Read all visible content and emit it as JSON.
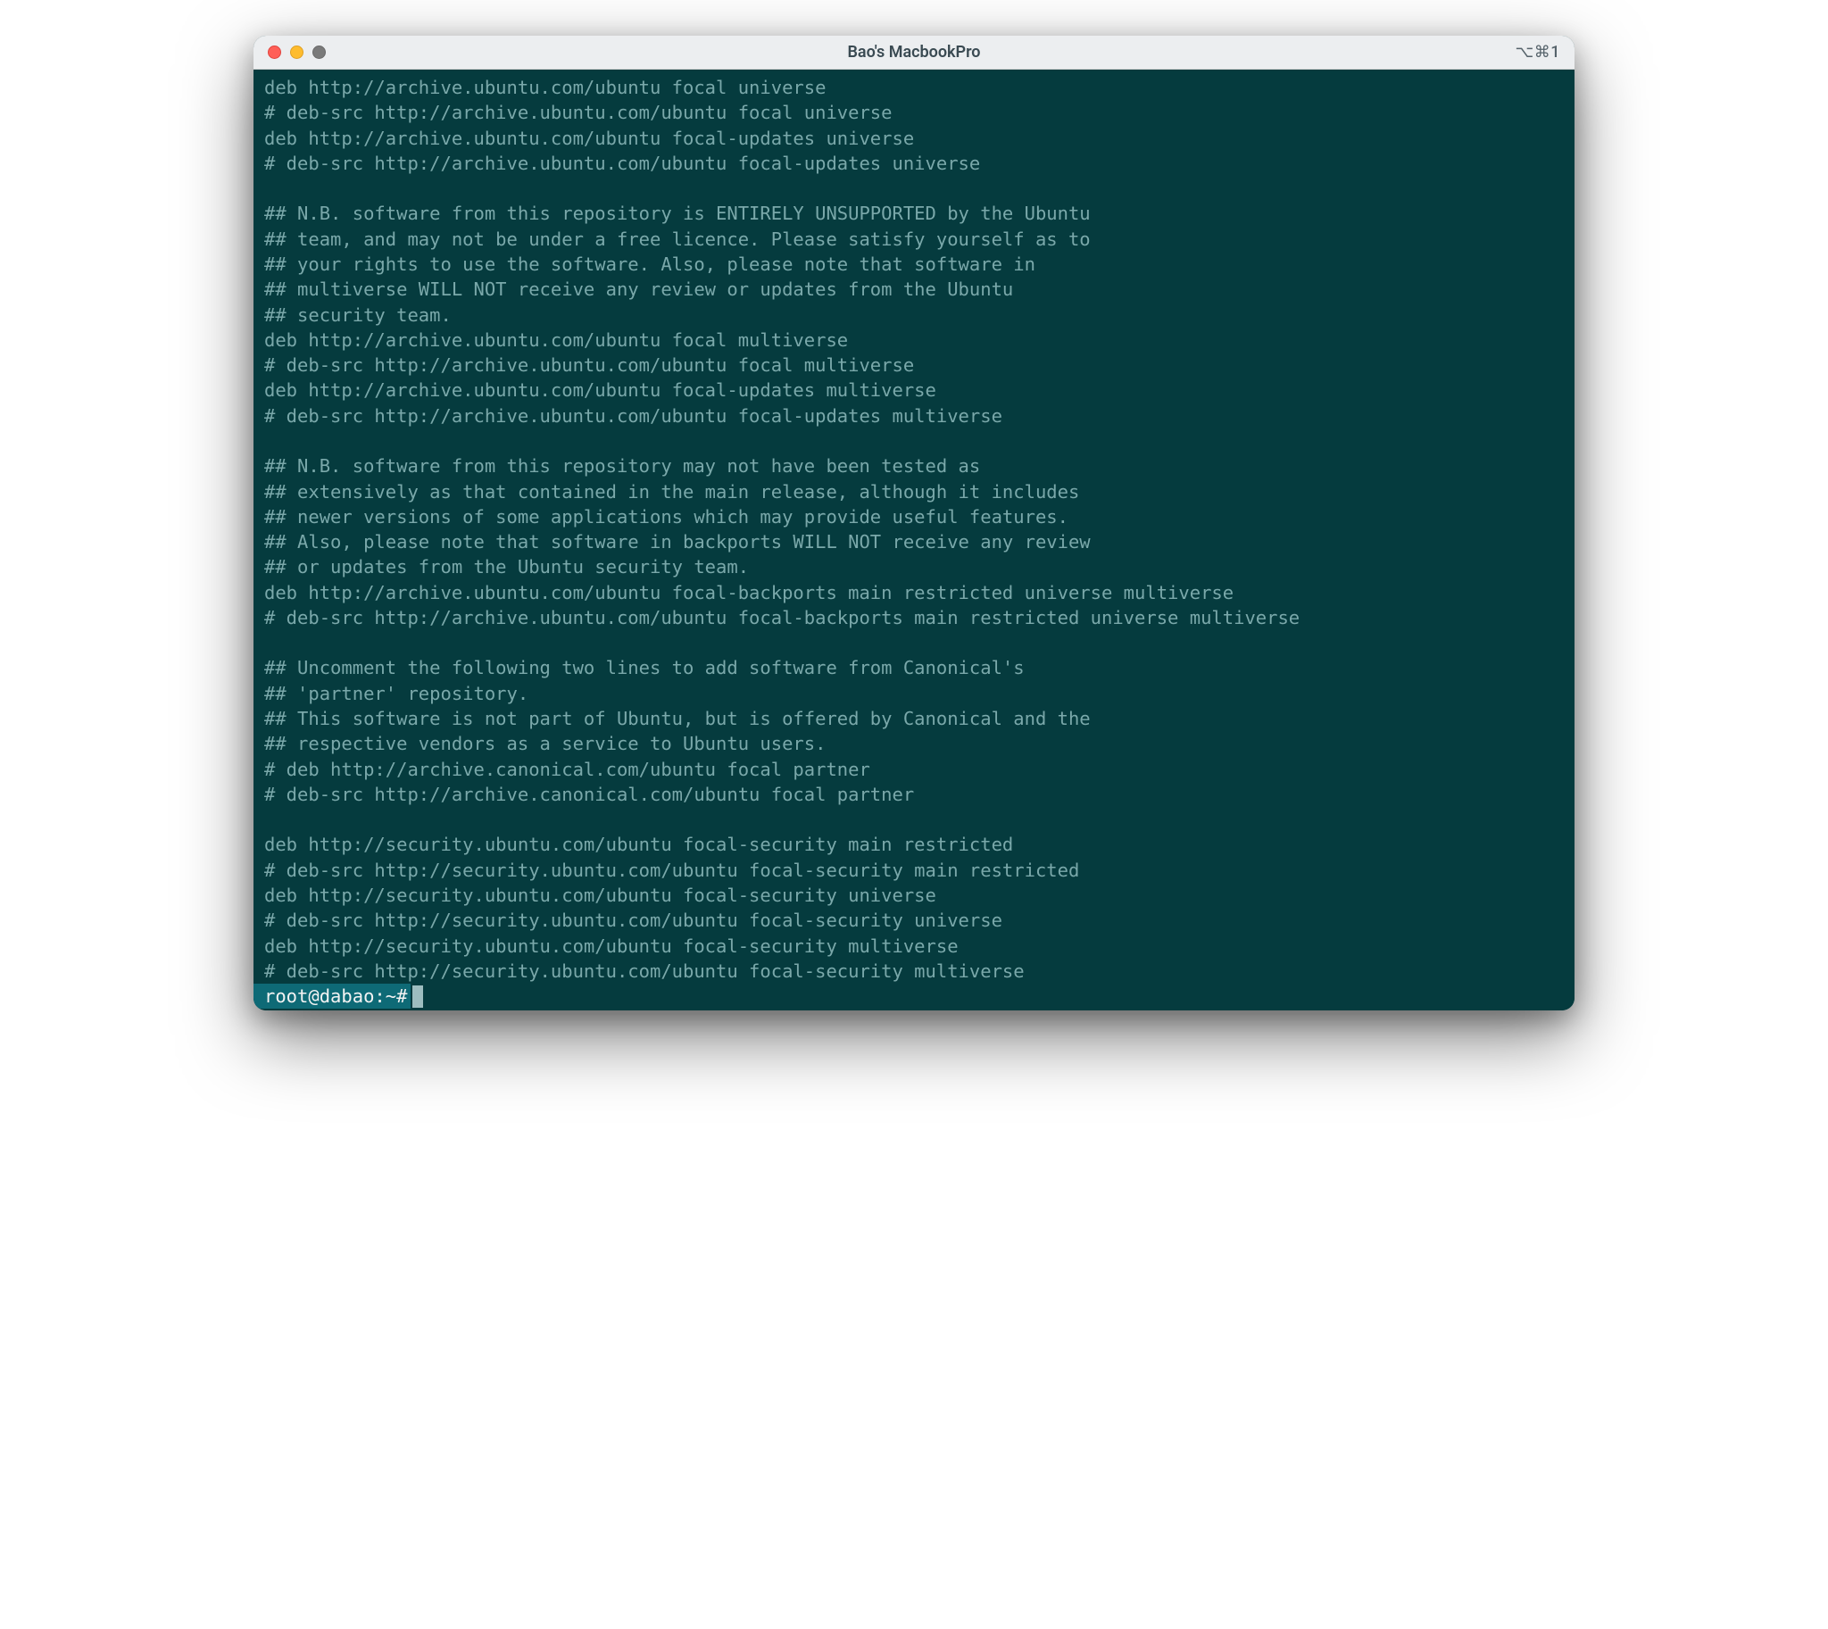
{
  "window": {
    "title": "Bao's MacbookPro",
    "shortcut": "⌥⌘1"
  },
  "terminal": {
    "lines": [
      "deb http://archive.ubuntu.com/ubuntu focal universe",
      "# deb-src http://archive.ubuntu.com/ubuntu focal universe",
      "deb http://archive.ubuntu.com/ubuntu focal-updates universe",
      "# deb-src http://archive.ubuntu.com/ubuntu focal-updates universe",
      "",
      "## N.B. software from this repository is ENTIRELY UNSUPPORTED by the Ubuntu",
      "## team, and may not be under a free licence. Please satisfy yourself as to",
      "## your rights to use the software. Also, please note that software in",
      "## multiverse WILL NOT receive any review or updates from the Ubuntu",
      "## security team.",
      "deb http://archive.ubuntu.com/ubuntu focal multiverse",
      "# deb-src http://archive.ubuntu.com/ubuntu focal multiverse",
      "deb http://archive.ubuntu.com/ubuntu focal-updates multiverse",
      "# deb-src http://archive.ubuntu.com/ubuntu focal-updates multiverse",
      "",
      "## N.B. software from this repository may not have been tested as",
      "## extensively as that contained in the main release, although it includes",
      "## newer versions of some applications which may provide useful features.",
      "## Also, please note that software in backports WILL NOT receive any review",
      "## or updates from the Ubuntu security team.",
      "deb http://archive.ubuntu.com/ubuntu focal-backports main restricted universe multiverse",
      "# deb-src http://archive.ubuntu.com/ubuntu focal-backports main restricted universe multiverse",
      "",
      "## Uncomment the following two lines to add software from Canonical's",
      "## 'partner' repository.",
      "## This software is not part of Ubuntu, but is offered by Canonical and the",
      "## respective vendors as a service to Ubuntu users.",
      "# deb http://archive.canonical.com/ubuntu focal partner",
      "# deb-src http://archive.canonical.com/ubuntu focal partner",
      "",
      "deb http://security.ubuntu.com/ubuntu focal-security main restricted",
      "# deb-src http://security.ubuntu.com/ubuntu focal-security main restricted",
      "deb http://security.ubuntu.com/ubuntu focal-security universe",
      "# deb-src http://security.ubuntu.com/ubuntu focal-security universe",
      "deb http://security.ubuntu.com/ubuntu focal-security multiverse",
      "# deb-src http://security.ubuntu.com/ubuntu focal-security multiverse"
    ],
    "prompt": "root@dabao:~#"
  }
}
